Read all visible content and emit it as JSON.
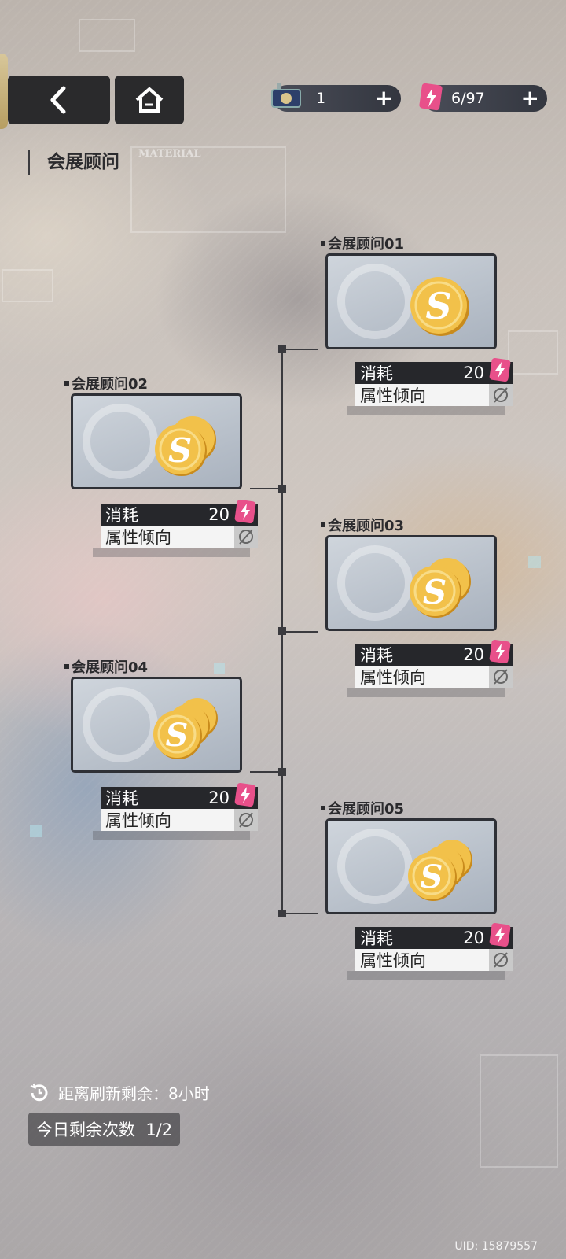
{
  "header": {
    "back_icon": "chevron-left-icon",
    "home_icon": "home-icon",
    "resource_ticket": {
      "value": "1",
      "plus": "+"
    },
    "resource_energy": {
      "value": "6/97",
      "plus": "+"
    }
  },
  "page_title": "会展顾问",
  "background_watermark": "MATERIAL",
  "nodes": [
    {
      "label": "会展顾问01",
      "cost_label": "消耗",
      "cost": "20",
      "attr_label": "属性倾向",
      "coins": 1
    },
    {
      "label": "会展顾问02",
      "cost_label": "消耗",
      "cost": "20",
      "attr_label": "属性倾向",
      "coins": 2
    },
    {
      "label": "会展顾问03",
      "cost_label": "消耗",
      "cost": "20",
      "attr_label": "属性倾向",
      "coins": 2
    },
    {
      "label": "会展顾问04",
      "cost_label": "消耗",
      "cost": "20",
      "attr_label": "属性倾向",
      "coins": 3
    },
    {
      "label": "会展顾问05",
      "cost_label": "消耗",
      "cost": "20",
      "attr_label": "属性倾向",
      "coins": 3
    }
  ],
  "footer": {
    "refresh_text": "距离刷新剩余：8小时",
    "remaining_text": "今日剩余次数  1/2",
    "uid": "UID: 15879557"
  },
  "colors": {
    "bolt_pink": "#e8508a",
    "coin_gold": "#e9b53a",
    "panel_dark": "#26272b"
  }
}
